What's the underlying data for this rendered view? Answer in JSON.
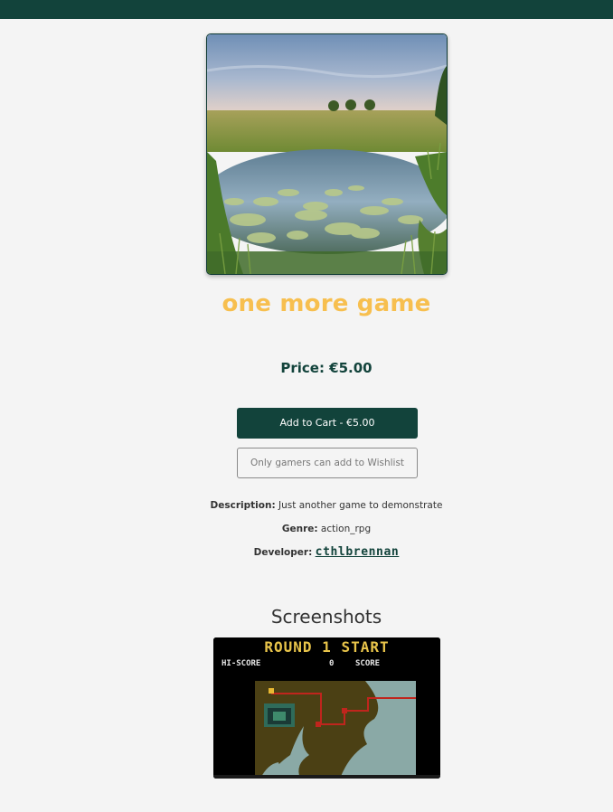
{
  "game": {
    "title": "one more game",
    "price_label": "Price: €5.00",
    "add_to_cart_label": "Add to Cart - €5.00",
    "wishlist_label": "Only gamers can add to Wishlist",
    "description_label": "Description:",
    "description_value": "Just another game to demonstrate",
    "genre_label": "Genre:",
    "genre_value": "action_rpg",
    "developer_label": "Developer:",
    "developer_value": "cthlbrennan"
  },
  "screenshots": {
    "heading": "Screenshots",
    "items": [
      {
        "round_text": "ROUND 1 START",
        "hiscore_label": "HI-SCORE",
        "hiscore_value": "0",
        "score_label": "SCORE"
      }
    ]
  },
  "colors": {
    "brand": "#12433b",
    "title": "#f7bf4f",
    "background": "#f4f4f4"
  }
}
